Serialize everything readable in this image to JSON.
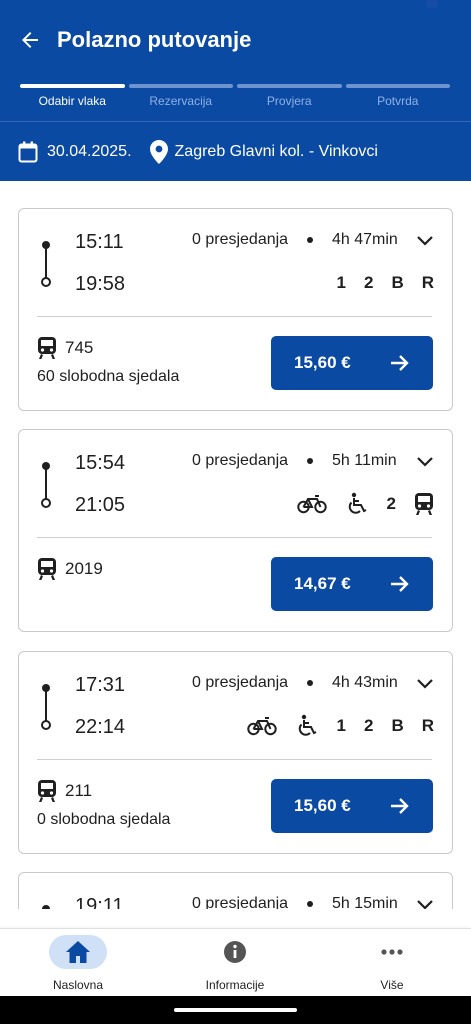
{
  "header": {
    "title": "Polazno putovanje",
    "back_icon": "arrow-left-icon",
    "steps": [
      {
        "label": "Odabir vlaka",
        "active": true
      },
      {
        "label": "Rezervacija",
        "active": false
      },
      {
        "label": "Provjera",
        "active": false
      },
      {
        "label": "Potvrda",
        "active": false
      }
    ],
    "date": "30.04.2025.",
    "route": "Zagreb Glavni kol. - Vinkovci",
    "accent_color": "#0b4aa2"
  },
  "trips": [
    {
      "departure": "15:11",
      "arrival": "19:58",
      "transfers": "0 presjedanja",
      "duration": "4h 47min",
      "amenities": [
        "1",
        "2",
        "B",
        "R"
      ],
      "train_number": "745",
      "seats": "60 slobodna sjedala",
      "price": "15,60 €"
    },
    {
      "departure": "15:54",
      "arrival": "21:05",
      "transfers": "0 presjedanja",
      "duration": "5h 11min",
      "amenities": [
        "bicycle-icon",
        "wheelchair-icon",
        "2",
        "train-icon"
      ],
      "train_number": "2019",
      "seats": "",
      "price": "14,67 €"
    },
    {
      "departure": "17:31",
      "arrival": "22:14",
      "transfers": "0 presjedanja",
      "duration": "4h 43min",
      "amenities": [
        "bicycle-icon",
        "wheelchair-icon",
        "1",
        "2",
        "B",
        "R"
      ],
      "train_number": "211",
      "seats": "0 slobodna sjedala",
      "price": "15,60 €"
    },
    {
      "departure": "19:11",
      "arrival": "",
      "transfers": "0 presjedanja",
      "duration": "5h 15min",
      "amenities": [],
      "train_number": "",
      "seats": "",
      "price": ""
    }
  ],
  "bottom_nav": [
    {
      "label": "Naslovna",
      "icon": "home-icon",
      "active": true
    },
    {
      "label": "Informacije",
      "icon": "info-icon",
      "active": false
    },
    {
      "label": "Više",
      "icon": "more-icon",
      "active": false
    }
  ]
}
